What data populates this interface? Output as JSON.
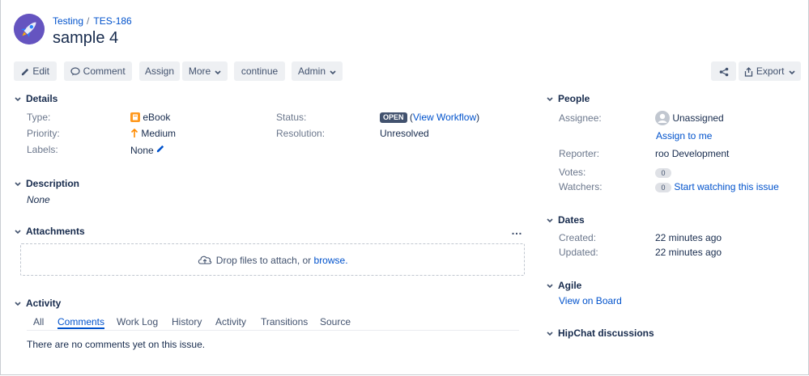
{
  "breadcrumb": {
    "project": "Testing",
    "issue_key": "TES-186",
    "separator": "/"
  },
  "issue": {
    "title": "sample 4"
  },
  "toolbar": {
    "edit": "Edit",
    "comment": "Comment",
    "assign": "Assign",
    "more": "More",
    "continue": "continue",
    "admin": "Admin",
    "export": "Export"
  },
  "details": {
    "header": "Details",
    "type_label": "Type:",
    "type_value": "eBook",
    "priority_label": "Priority:",
    "priority_value": "Medium",
    "labels_label": "Labels:",
    "labels_value": "None",
    "status_label": "Status:",
    "status_value": "OPEN",
    "view_workflow": "View Workflow",
    "resolution_label": "Resolution:",
    "resolution_value": "Unresolved"
  },
  "description": {
    "header": "Description",
    "value": "None"
  },
  "attachments": {
    "header": "Attachments",
    "more": "…",
    "drop_text": "Drop files to attach, or",
    "browse": "browse."
  },
  "activity": {
    "header": "Activity",
    "tabs": [
      "All",
      "Comments",
      "Work Log",
      "History",
      "Activity",
      "Transitions",
      "Source"
    ],
    "active_tab": "Comments",
    "empty": "There are no comments yet on this issue."
  },
  "people": {
    "header": "People",
    "assignee_label": "Assignee:",
    "assignee_value": "Unassigned",
    "assign_to_me": "Assign to me",
    "reporter_label": "Reporter:",
    "reporter_prefix": "roo",
    "reporter_value": "Development",
    "votes_label": "Votes:",
    "votes_count": "0",
    "watchers_label": "Watchers:",
    "watchers_count": "0",
    "start_watching": "Start watching this issue"
  },
  "dates": {
    "header": "Dates",
    "created_label": "Created:",
    "created_value": "22 minutes ago",
    "updated_label": "Updated:",
    "updated_value": "22 minutes ago"
  },
  "agile": {
    "header": "Agile",
    "view_on_board": "View on Board"
  },
  "hipchat": {
    "header": "HipChat discussions"
  },
  "colors": {
    "link": "#0052cc",
    "status_lozenge": "#42526e",
    "priority": "#ff8b00",
    "ebook_icon": "#ff991f"
  }
}
